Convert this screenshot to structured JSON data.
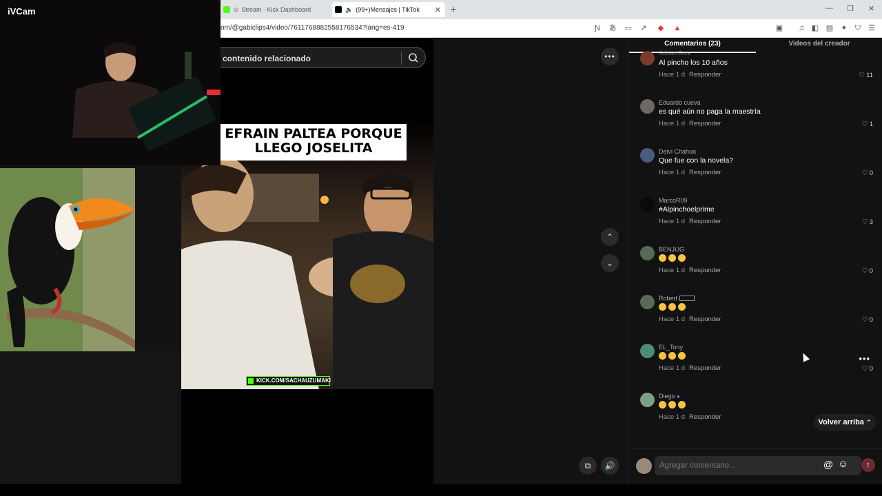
{
  "browser": {
    "tabs": [
      {
        "label": "Stream - Kick Dashboard",
        "active": false,
        "favicon_color": "#53fc18"
      },
      {
        "label": "(99+)Mensajes | TikTok",
        "active": true,
        "favicon_color": "#000000"
      }
    ],
    "new_tab": "+",
    "url": "om/@gabiclips4/video/7611768882558176534?lang=es-419",
    "window_controls": {
      "minimize": "—",
      "restore": "❐",
      "close": "✕"
    }
  },
  "overlay": {
    "webcam_label": "iVCam"
  },
  "tiktok": {
    "search_text": "contenido relacionado",
    "video_caption": "EFRAIN PALTEA PORQUE LLEGO JOSELITA",
    "kick_banner": "KICK.COM/SACHAUZUMAKI",
    "tabs": [
      {
        "label": "Comentarios (23)",
        "active": true
      },
      {
        "label": "Videos del creador",
        "active": false
      }
    ],
    "comments": [
      {
        "user": "Adrian Arce",
        "text": "Al pincho los 10 años",
        "time": "Hace 1 d",
        "reply": "Responder",
        "likes": "11",
        "avatar_color": "#7a3b2e"
      },
      {
        "user": "Eduardo cueva",
        "text": "es qué aún no paga la maestría",
        "time": "Hace 1 d",
        "reply": "Responder",
        "likes": "1",
        "avatar_color": "#6d6a66"
      },
      {
        "user": "Deivi Chahua",
        "text": "Que fue con la novela?",
        "time": "Hace 1 d",
        "reply": "Responder",
        "likes": "0",
        "avatar_color": "#4a5a80"
      },
      {
        "user": "MarcoR09",
        "text": "#Alpinchoelprime",
        "time": "Hace 1 d",
        "reply": "Responder",
        "likes": "3",
        "avatar_color": "#0a0a0a"
      },
      {
        "user": "BENJIJG",
        "text": "",
        "emoji_count": 3,
        "time": "Hace 1 d",
        "reply": "Responder",
        "likes": "0",
        "avatar_color": "#556b55"
      },
      {
        "user": "Robert",
        "text": "",
        "emoji_count": 3,
        "time": "Hace 1 d",
        "reply": "Responder",
        "likes": "0",
        "avatar_color": "#5a6a5a"
      },
      {
        "user": "EL_Tony",
        "text": "",
        "emoji_count": 3,
        "time": "Hace 1 d",
        "reply": "Responder",
        "likes": "0",
        "avatar_color": "#4d8a7a"
      },
      {
        "user": "Diego",
        "text": "",
        "emoji_count": 3,
        "time": "Hace 1 d",
        "reply": "Responder",
        "likes": "",
        "avatar_color": "#7aa08a"
      }
    ],
    "back_to_top": "Volver arriba",
    "comment_placeholder": "Agregar comentario...",
    "colors": {
      "accent": "#fe2c55",
      "send_disabled": "#6b2b35",
      "kick_green": "#53fc18"
    }
  }
}
